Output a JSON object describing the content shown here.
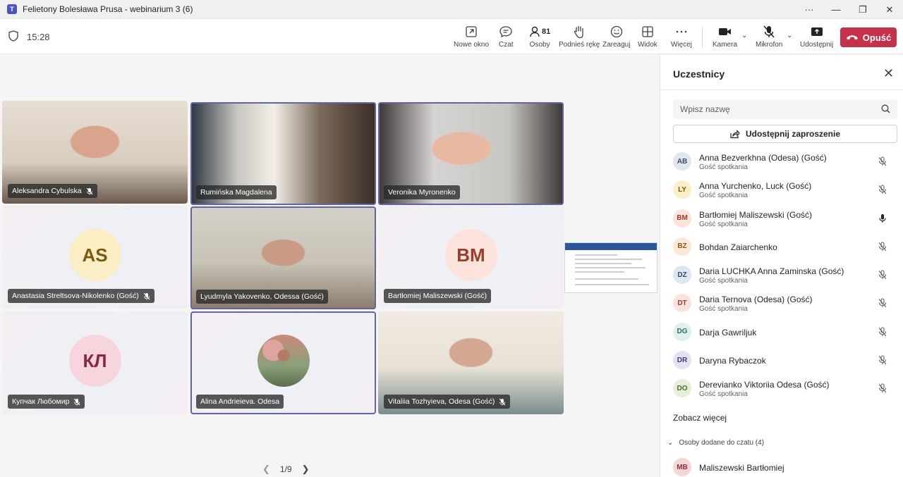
{
  "window": {
    "title": "Felietony Bolesława Prusa - webinarium 3 (6)",
    "controls": [
      "···",
      "—",
      "❐",
      "✕"
    ]
  },
  "toolbar": {
    "timer": "15:28",
    "buttons": [
      {
        "label": "Nowe okno",
        "icon": "new-window-icon"
      },
      {
        "label": "Czat",
        "icon": "chat-icon"
      },
      {
        "label": "Osoby",
        "icon": "people-icon",
        "count": "81",
        "active": true
      },
      {
        "label": "Podnieś rękę",
        "icon": "raise-hand-icon"
      },
      {
        "label": "Zareaguj",
        "icon": "react-icon"
      },
      {
        "label": "Widok",
        "icon": "view-icon"
      },
      {
        "label": "Więcej",
        "icon": "more-icon"
      },
      {
        "label": "Kamera",
        "icon": "camera-icon"
      },
      {
        "label": "Mikrofon",
        "icon": "mic-off-icon"
      },
      {
        "label": "Udostępnij",
        "icon": "share-icon"
      }
    ],
    "leave_label": "Opuść",
    "leave_color": "#c4314b"
  },
  "stage": {
    "tiles": [
      {
        "name": "Aleksandra Cybulska",
        "muted": true,
        "type": "video"
      },
      {
        "name": "Rumińska Magdalena",
        "muted": false,
        "type": "video",
        "speaking": true
      },
      {
        "name": "Veronika Myronenko",
        "muted": false,
        "type": "video",
        "speaking": true
      },
      {
        "name": "Anastasia Streltsova-Nikolenko (Gość)",
        "muted": true,
        "type": "initials",
        "initials": "AS",
        "bg": "#fbedc4",
        "fg": "#7a5a0d"
      },
      {
        "name": "Lyudmyla Yakovenko, Odessa (Gość)",
        "muted": false,
        "type": "video",
        "speaking": true
      },
      {
        "name": "Bartłomiej Maliszewski (Gość)",
        "muted": false,
        "type": "initials",
        "initials": "BM",
        "bg": "#fbe3dc",
        "fg": "#9a3e2a"
      },
      {
        "name": "Купчак Любомир",
        "muted": true,
        "type": "initials",
        "initials": "КЛ",
        "bg": "#f6d5dd",
        "fg": "#8a2742"
      },
      {
        "name": "Alina Andrieieva. Odesa",
        "muted": false,
        "type": "photo",
        "speaking": true
      },
      {
        "name": "Vitaliia Tozhyieva, Odesa (Gość)",
        "muted": true,
        "type": "video"
      }
    ],
    "pager": "1/9"
  },
  "panel": {
    "title": "Uczestnicy",
    "search_placeholder": "Wpisz nazwę",
    "invite_label": "Udostępnij zaproszenie",
    "participants": [
      {
        "initials": "AB",
        "name": "Anna Bezverkhna (Odesa) (Gość)",
        "role": "Gość spotkania",
        "mic": "off",
        "bg": "#dfe6ee",
        "fg": "#3b4d63"
      },
      {
        "initials": "LY",
        "name": "Anna Yurchenko, Luck (Gość)",
        "role": "Gość spotkania",
        "mic": "off",
        "bg": "#fbefc8",
        "fg": "#7a5a0d"
      },
      {
        "initials": "BM",
        "name": "Bartłomiej Maliszewski (Gość)",
        "role": "Gość spotkania",
        "mic": "on",
        "bg": "#fbe3dc",
        "fg": "#9a3e2a"
      },
      {
        "initials": "BZ",
        "name": "Bohdan Zaiarchenko",
        "role": "",
        "mic": "off",
        "bg": "#fbe9d6",
        "fg": "#8a5a1e"
      },
      {
        "initials": "DZ",
        "name": "Daria LUCHKA Anna Zaminska (Gość)",
        "role": "Gość spotkania",
        "mic": "off",
        "bg": "#dde6f2",
        "fg": "#2f4c73"
      },
      {
        "initials": "DT",
        "name": "Daria Ternova (Odesa) (Gość)",
        "role": "Gość spotkania",
        "mic": "off",
        "bg": "#fbe3dc",
        "fg": "#9a3e2a"
      },
      {
        "initials": "DG",
        "name": "Darja Gawriljuk",
        "role": "",
        "mic": "off",
        "bg": "#dff0ee",
        "fg": "#2d6b63"
      },
      {
        "initials": "DR",
        "name": "Daryna Rybaczok",
        "role": "",
        "mic": "off",
        "bg": "#e4e1f2",
        "fg": "#43387a"
      },
      {
        "initials": "DO",
        "name": "Derevianko Viktoriia Odesa (Gość)",
        "role": "Gość spotkania",
        "mic": "off",
        "bg": "#e6f0d9",
        "fg": "#486b2a"
      }
    ],
    "see_more": "Zobacz więcej",
    "section_label": "Osoby dodane do czatu (4)",
    "chat_people": [
      {
        "initials": "MB",
        "name": "Maliszewski Bartłomiej"
      }
    ]
  }
}
